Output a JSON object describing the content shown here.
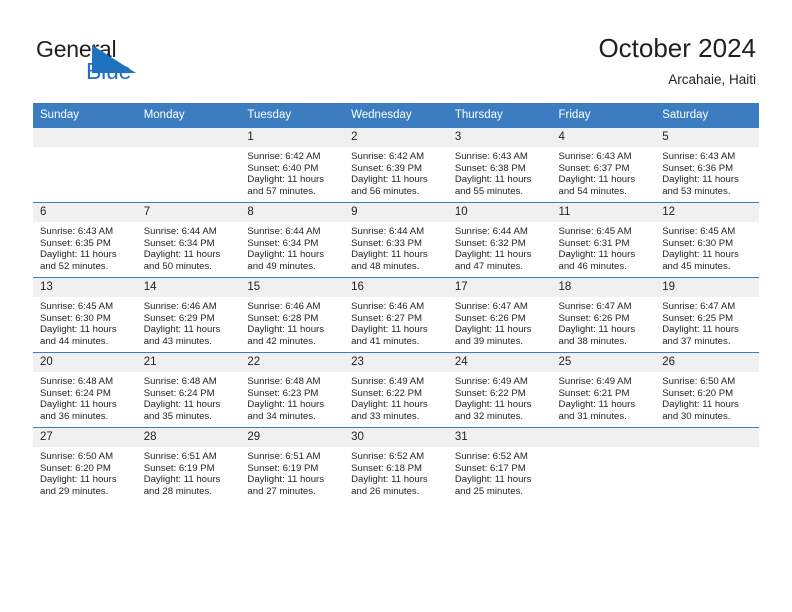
{
  "logo": {
    "word1": "General",
    "word2": "Blue",
    "triangle_color": "#1f72bd",
    "text_color": "#231f20",
    "icon": "general-blue-logo"
  },
  "header": {
    "title": "October 2024",
    "subtitle": "Arcahaie, Haiti"
  },
  "theme": {
    "header_blue": "#3b7dc0",
    "daynum_gray": "#f0f0f0",
    "text": "#231f20",
    "page_bg": "#ffffff"
  },
  "calendar": {
    "weekday_headers": [
      "Sunday",
      "Monday",
      "Tuesday",
      "Wednesday",
      "Thursday",
      "Friday",
      "Saturday"
    ],
    "weeks": [
      [
        {
          "day": "",
          "sunrise": "",
          "sunset": "",
          "daylight_line1": "",
          "daylight_line2": ""
        },
        {
          "day": "",
          "sunrise": "",
          "sunset": "",
          "daylight_line1": "",
          "daylight_line2": ""
        },
        {
          "day": "1",
          "sunrise": "Sunrise: 6:42 AM",
          "sunset": "Sunset: 6:40 PM",
          "daylight_line1": "Daylight: 11 hours",
          "daylight_line2": "and 57 minutes."
        },
        {
          "day": "2",
          "sunrise": "Sunrise: 6:42 AM",
          "sunset": "Sunset: 6:39 PM",
          "daylight_line1": "Daylight: 11 hours",
          "daylight_line2": "and 56 minutes."
        },
        {
          "day": "3",
          "sunrise": "Sunrise: 6:43 AM",
          "sunset": "Sunset: 6:38 PM",
          "daylight_line1": "Daylight: 11 hours",
          "daylight_line2": "and 55 minutes."
        },
        {
          "day": "4",
          "sunrise": "Sunrise: 6:43 AM",
          "sunset": "Sunset: 6:37 PM",
          "daylight_line1": "Daylight: 11 hours",
          "daylight_line2": "and 54 minutes."
        },
        {
          "day": "5",
          "sunrise": "Sunrise: 6:43 AM",
          "sunset": "Sunset: 6:36 PM",
          "daylight_line1": "Daylight: 11 hours",
          "daylight_line2": "and 53 minutes."
        }
      ],
      [
        {
          "day": "6",
          "sunrise": "Sunrise: 6:43 AM",
          "sunset": "Sunset: 6:35 PM",
          "daylight_line1": "Daylight: 11 hours",
          "daylight_line2": "and 52 minutes."
        },
        {
          "day": "7",
          "sunrise": "Sunrise: 6:44 AM",
          "sunset": "Sunset: 6:34 PM",
          "daylight_line1": "Daylight: 11 hours",
          "daylight_line2": "and 50 minutes."
        },
        {
          "day": "8",
          "sunrise": "Sunrise: 6:44 AM",
          "sunset": "Sunset: 6:34 PM",
          "daylight_line1": "Daylight: 11 hours",
          "daylight_line2": "and 49 minutes."
        },
        {
          "day": "9",
          "sunrise": "Sunrise: 6:44 AM",
          "sunset": "Sunset: 6:33 PM",
          "daylight_line1": "Daylight: 11 hours",
          "daylight_line2": "and 48 minutes."
        },
        {
          "day": "10",
          "sunrise": "Sunrise: 6:44 AM",
          "sunset": "Sunset: 6:32 PM",
          "daylight_line1": "Daylight: 11 hours",
          "daylight_line2": "and 47 minutes."
        },
        {
          "day": "11",
          "sunrise": "Sunrise: 6:45 AM",
          "sunset": "Sunset: 6:31 PM",
          "daylight_line1": "Daylight: 11 hours",
          "daylight_line2": "and 46 minutes."
        },
        {
          "day": "12",
          "sunrise": "Sunrise: 6:45 AM",
          "sunset": "Sunset: 6:30 PM",
          "daylight_line1": "Daylight: 11 hours",
          "daylight_line2": "and 45 minutes."
        }
      ],
      [
        {
          "day": "13",
          "sunrise": "Sunrise: 6:45 AM",
          "sunset": "Sunset: 6:30 PM",
          "daylight_line1": "Daylight: 11 hours",
          "daylight_line2": "and 44 minutes."
        },
        {
          "day": "14",
          "sunrise": "Sunrise: 6:46 AM",
          "sunset": "Sunset: 6:29 PM",
          "daylight_line1": "Daylight: 11 hours",
          "daylight_line2": "and 43 minutes."
        },
        {
          "day": "15",
          "sunrise": "Sunrise: 6:46 AM",
          "sunset": "Sunset: 6:28 PM",
          "daylight_line1": "Daylight: 11 hours",
          "daylight_line2": "and 42 minutes."
        },
        {
          "day": "16",
          "sunrise": "Sunrise: 6:46 AM",
          "sunset": "Sunset: 6:27 PM",
          "daylight_line1": "Daylight: 11 hours",
          "daylight_line2": "and 41 minutes."
        },
        {
          "day": "17",
          "sunrise": "Sunrise: 6:47 AM",
          "sunset": "Sunset: 6:26 PM",
          "daylight_line1": "Daylight: 11 hours",
          "daylight_line2": "and 39 minutes."
        },
        {
          "day": "18",
          "sunrise": "Sunrise: 6:47 AM",
          "sunset": "Sunset: 6:26 PM",
          "daylight_line1": "Daylight: 11 hours",
          "daylight_line2": "and 38 minutes."
        },
        {
          "day": "19",
          "sunrise": "Sunrise: 6:47 AM",
          "sunset": "Sunset: 6:25 PM",
          "daylight_line1": "Daylight: 11 hours",
          "daylight_line2": "and 37 minutes."
        }
      ],
      [
        {
          "day": "20",
          "sunrise": "Sunrise: 6:48 AM",
          "sunset": "Sunset: 6:24 PM",
          "daylight_line1": "Daylight: 11 hours",
          "daylight_line2": "and 36 minutes."
        },
        {
          "day": "21",
          "sunrise": "Sunrise: 6:48 AM",
          "sunset": "Sunset: 6:24 PM",
          "daylight_line1": "Daylight: 11 hours",
          "daylight_line2": "and 35 minutes."
        },
        {
          "day": "22",
          "sunrise": "Sunrise: 6:48 AM",
          "sunset": "Sunset: 6:23 PM",
          "daylight_line1": "Daylight: 11 hours",
          "daylight_line2": "and 34 minutes."
        },
        {
          "day": "23",
          "sunrise": "Sunrise: 6:49 AM",
          "sunset": "Sunset: 6:22 PM",
          "daylight_line1": "Daylight: 11 hours",
          "daylight_line2": "and 33 minutes."
        },
        {
          "day": "24",
          "sunrise": "Sunrise: 6:49 AM",
          "sunset": "Sunset: 6:22 PM",
          "daylight_line1": "Daylight: 11 hours",
          "daylight_line2": "and 32 minutes."
        },
        {
          "day": "25",
          "sunrise": "Sunrise: 6:49 AM",
          "sunset": "Sunset: 6:21 PM",
          "daylight_line1": "Daylight: 11 hours",
          "daylight_line2": "and 31 minutes."
        },
        {
          "day": "26",
          "sunrise": "Sunrise: 6:50 AM",
          "sunset": "Sunset: 6:20 PM",
          "daylight_line1": "Daylight: 11 hours",
          "daylight_line2": "and 30 minutes."
        }
      ],
      [
        {
          "day": "27",
          "sunrise": "Sunrise: 6:50 AM",
          "sunset": "Sunset: 6:20 PM",
          "daylight_line1": "Daylight: 11 hours",
          "daylight_line2": "and 29 minutes."
        },
        {
          "day": "28",
          "sunrise": "Sunrise: 6:51 AM",
          "sunset": "Sunset: 6:19 PM",
          "daylight_line1": "Daylight: 11 hours",
          "daylight_line2": "and 28 minutes."
        },
        {
          "day": "29",
          "sunrise": "Sunrise: 6:51 AM",
          "sunset": "Sunset: 6:19 PM",
          "daylight_line1": "Daylight: 11 hours",
          "daylight_line2": "and 27 minutes."
        },
        {
          "day": "30",
          "sunrise": "Sunrise: 6:52 AM",
          "sunset": "Sunset: 6:18 PM",
          "daylight_line1": "Daylight: 11 hours",
          "daylight_line2": "and 26 minutes."
        },
        {
          "day": "31",
          "sunrise": "Sunrise: 6:52 AM",
          "sunset": "Sunset: 6:17 PM",
          "daylight_line1": "Daylight: 11 hours",
          "daylight_line2": "and 25 minutes."
        },
        {
          "day": "",
          "sunrise": "",
          "sunset": "",
          "daylight_line1": "",
          "daylight_line2": ""
        },
        {
          "day": "",
          "sunrise": "",
          "sunset": "",
          "daylight_line1": "",
          "daylight_line2": ""
        }
      ]
    ]
  }
}
